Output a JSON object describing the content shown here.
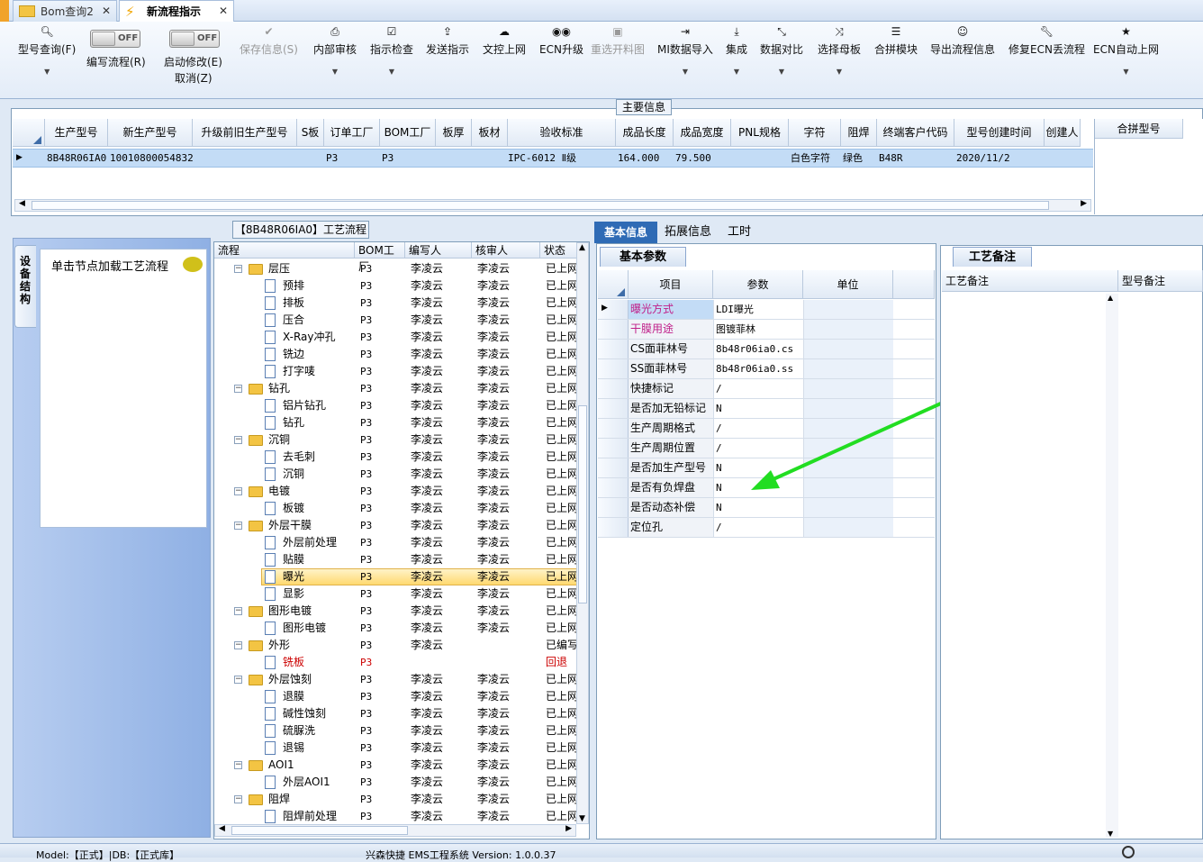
{
  "tabs": [
    {
      "label": "Bom查询2",
      "icon": "folder-icon"
    },
    {
      "label": "新流程指示",
      "icon": "lightning-icon"
    }
  ],
  "toolbar": {
    "model_query": "型号查询(F)",
    "toggle_off": "OFF",
    "edit_flow": "编写流程(R)",
    "start_modify": "启动修改(E)",
    "cancel": "取消(Z)",
    "save_info": "保存信息(S)",
    "internal_review": "内部审核",
    "instruction_check": "指示检查",
    "send_instruction": "发送指示",
    "doc_upload": "文控上网",
    "ecn_upgrade": "ECN升级",
    "reselect_cut": "重选开料图",
    "mi_import": "MI数据导入",
    "integrate": "集成",
    "data_compare": "数据对比",
    "select_master": "选择母板",
    "merge_module": "合拼模块",
    "export_flow": "导出流程信息",
    "fix_ecn": "修复ECN丢流程",
    "ecn_auto": "ECN自动上网"
  },
  "main_info": {
    "title": "主要信息",
    "columns": [
      "生产型号",
      "新生产型号",
      "升级前旧生产型号",
      "S板",
      "订单工厂",
      "BOM工厂",
      "板厚",
      "板材",
      "验收标准",
      "成品长度",
      "成品宽度",
      "PNL规格",
      "字符",
      "阻焊",
      "终端客户代码",
      "型号创建时间",
      "创建人"
    ],
    "row": [
      "8B48R06IA0",
      "10010800054832",
      "",
      "",
      "P3",
      "P3",
      "",
      "",
      "IPC-6012 Ⅱ级",
      "164.000",
      "79.500",
      "",
      "白色字符",
      "绿色",
      "B48R",
      "2020/11/2",
      ""
    ],
    "merge_header": "合拼型号"
  },
  "left_panel": {
    "tab_label": "设备结构",
    "node_hint": "单击节点加载工艺流程"
  },
  "tree": {
    "title": "【8B48R06IA0】工艺流程",
    "columns": [
      "流程",
      "BOM工厂",
      "编写人",
      "核审人",
      "状态"
    ],
    "rows": [
      {
        "name": "层压",
        "level": 0,
        "bom": "P3",
        "writer": "李凌云",
        "reviewer": "李凌云",
        "status": "已上网"
      },
      {
        "name": "预排",
        "level": 1,
        "bom": "P3",
        "writer": "李凌云",
        "reviewer": "李凌云",
        "status": "已上网"
      },
      {
        "name": "排板",
        "level": 1,
        "bom": "P3",
        "writer": "李凌云",
        "reviewer": "李凌云",
        "status": "已上网"
      },
      {
        "name": "压合",
        "level": 1,
        "bom": "P3",
        "writer": "李凌云",
        "reviewer": "李凌云",
        "status": "已上网"
      },
      {
        "name": "X-Ray冲孔",
        "level": 1,
        "bom": "P3",
        "writer": "李凌云",
        "reviewer": "李凌云",
        "status": "已上网"
      },
      {
        "name": "铣边",
        "level": 1,
        "bom": "P3",
        "writer": "李凌云",
        "reviewer": "李凌云",
        "status": "已上网"
      },
      {
        "name": "打字唛",
        "level": 1,
        "bom": "P3",
        "writer": "李凌云",
        "reviewer": "李凌云",
        "status": "已上网"
      },
      {
        "name": "钻孔",
        "level": 0,
        "bom": "P3",
        "writer": "李凌云",
        "reviewer": "李凌云",
        "status": "已上网"
      },
      {
        "name": "铝片钻孔",
        "level": 1,
        "bom": "P3",
        "writer": "李凌云",
        "reviewer": "李凌云",
        "status": "已上网"
      },
      {
        "name": "钻孔",
        "level": 1,
        "bom": "P3",
        "writer": "李凌云",
        "reviewer": "李凌云",
        "status": "已上网"
      },
      {
        "name": "沉铜",
        "level": 0,
        "bom": "P3",
        "writer": "李凌云",
        "reviewer": "李凌云",
        "status": "已上网"
      },
      {
        "name": "去毛刺",
        "level": 1,
        "bom": "P3",
        "writer": "李凌云",
        "reviewer": "李凌云",
        "status": "已上网"
      },
      {
        "name": "沉铜",
        "level": 1,
        "bom": "P3",
        "writer": "李凌云",
        "reviewer": "李凌云",
        "status": "已上网"
      },
      {
        "name": "电镀",
        "level": 0,
        "bom": "P3",
        "writer": "李凌云",
        "reviewer": "李凌云",
        "status": "已上网"
      },
      {
        "name": "板镀",
        "level": 1,
        "bom": "P3",
        "writer": "李凌云",
        "reviewer": "李凌云",
        "status": "已上网"
      },
      {
        "name": "外层干膜",
        "level": 0,
        "bom": "P3",
        "writer": "李凌云",
        "reviewer": "李凌云",
        "status": "已上网"
      },
      {
        "name": "外层前处理",
        "level": 1,
        "bom": "P3",
        "writer": "李凌云",
        "reviewer": "李凌云",
        "status": "已上网"
      },
      {
        "name": "贴膜",
        "level": 1,
        "bom": "P3",
        "writer": "李凌云",
        "reviewer": "李凌云",
        "status": "已上网"
      },
      {
        "name": "曝光",
        "level": 1,
        "bom": "P3",
        "writer": "李凌云",
        "reviewer": "李凌云",
        "status": "已上网",
        "selected": true
      },
      {
        "name": "显影",
        "level": 1,
        "bom": "P3",
        "writer": "李凌云",
        "reviewer": "李凌云",
        "status": "已上网"
      },
      {
        "name": "图形电镀",
        "level": 0,
        "bom": "P3",
        "writer": "李凌云",
        "reviewer": "李凌云",
        "status": "已上网"
      },
      {
        "name": "图形电镀",
        "level": 1,
        "bom": "P3",
        "writer": "李凌云",
        "reviewer": "李凌云",
        "status": "已上网"
      },
      {
        "name": "外形",
        "level": 0,
        "bom": "P3",
        "writer": "李凌云",
        "reviewer": "",
        "status": "已编写"
      },
      {
        "name": "铣板",
        "level": 1,
        "bom": "P3",
        "writer": "",
        "reviewer": "",
        "status": "回退",
        "red": true
      },
      {
        "name": "外层蚀刻",
        "level": 0,
        "bom": "P3",
        "writer": "李凌云",
        "reviewer": "李凌云",
        "status": "已上网"
      },
      {
        "name": "退膜",
        "level": 1,
        "bom": "P3",
        "writer": "李凌云",
        "reviewer": "李凌云",
        "status": "已上网"
      },
      {
        "name": "碱性蚀刻",
        "level": 1,
        "bom": "P3",
        "writer": "李凌云",
        "reviewer": "李凌云",
        "status": "已上网"
      },
      {
        "name": "硫脲洗",
        "level": 1,
        "bom": "P3",
        "writer": "李凌云",
        "reviewer": "李凌云",
        "status": "已上网"
      },
      {
        "name": "退锡",
        "level": 1,
        "bom": "P3",
        "writer": "李凌云",
        "reviewer": "李凌云",
        "status": "已上网"
      },
      {
        "name": "AOI1",
        "level": 0,
        "bom": "P3",
        "writer": "李凌云",
        "reviewer": "李凌云",
        "status": "已上网"
      },
      {
        "name": "外层AOI1",
        "level": 1,
        "bom": "P3",
        "writer": "李凌云",
        "reviewer": "李凌云",
        "status": "已上网"
      },
      {
        "name": "阻焊",
        "level": 0,
        "bom": "P3",
        "writer": "李凌云",
        "reviewer": "李凌云",
        "status": "已上网"
      },
      {
        "name": "阻焊前处理",
        "level": 1,
        "bom": "P3",
        "writer": "李凌云",
        "reviewer": "李凌云",
        "status": "已上网"
      }
    ]
  },
  "right_tabs": [
    "基本信息",
    "拓展信息",
    "工时"
  ],
  "basic": {
    "tab": "基本参数",
    "columns": [
      "项目",
      "参数",
      "单位"
    ],
    "rows": [
      {
        "k": "曝光方式",
        "v": "LDI曝光",
        "pink": true
      },
      {
        "k": "干膜用途",
        "v": "图镀菲林",
        "pink": true
      },
      {
        "k": "CS面菲林号",
        "v": "8b48r06ia0.cs"
      },
      {
        "k": "SS面菲林号",
        "v": "8b48r06ia0.ss"
      },
      {
        "k": "快捷标记",
        "v": "/"
      },
      {
        "k": "是否加无铅标记",
        "v": "N"
      },
      {
        "k": "生产周期格式",
        "v": "/"
      },
      {
        "k": "生产周期位置",
        "v": "/"
      },
      {
        "k": "是否加生产型号",
        "v": "N"
      },
      {
        "k": "是否有负焊盘",
        "v": "N"
      },
      {
        "k": "是否动态补偿",
        "v": "N"
      },
      {
        "k": "定位孔",
        "v": "/"
      }
    ]
  },
  "notes": {
    "tab": "工艺备注",
    "col1": "工艺备注",
    "col2": "型号备注"
  },
  "status": {
    "left": "Model:【正式】|DB:【正式库】",
    "center": "兴森快捷 EMS工程系统 Version: 1.0.0.37"
  },
  "colors": {
    "accent": "#2f6bb5",
    "selected_row": "#c3dcf6",
    "pink_text": "#c0208a",
    "arrow": "#22dd22"
  }
}
